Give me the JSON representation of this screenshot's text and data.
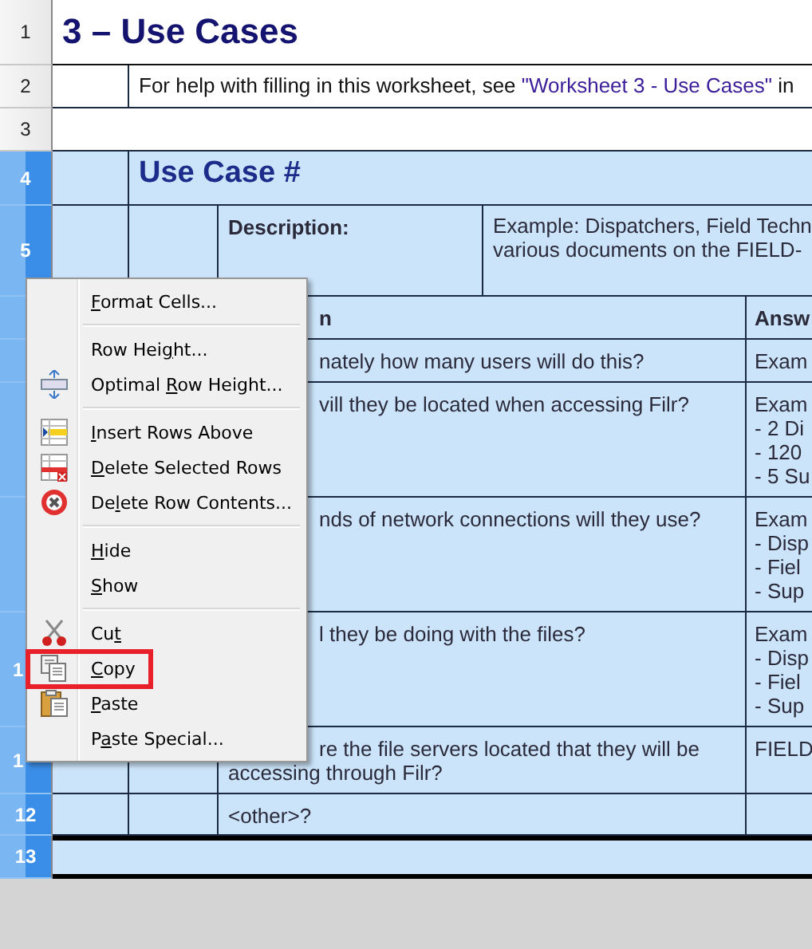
{
  "row_headers": [
    {
      "label": "1",
      "selected": false
    },
    {
      "label": "2",
      "selected": false
    },
    {
      "label": "3",
      "selected": false
    },
    {
      "label": "4",
      "selected": true
    },
    {
      "label": "5",
      "selected": true
    },
    {
      "selected": true
    },
    {
      "selected": true
    },
    {
      "selected": true
    },
    {
      "selected": true
    },
    {
      "label": "1",
      "selected": true,
      "covered": true
    },
    {
      "label": "1",
      "selected": true,
      "covered": true
    },
    {
      "label": "12",
      "selected": true
    },
    {
      "label": "13",
      "selected": true
    }
  ],
  "sheet": {
    "title": "3 – Use Cases",
    "help": {
      "before": "For help with filling in this worksheet, see ",
      "link": "\"Worksheet 3 - Use Cases\"",
      "after": " in"
    },
    "section_title": "Use Case #",
    "description_label": "Description:",
    "description_lines": [
      "Example: Dispatchers, Field Techn",
      "various documents on the FIELD-"
    ],
    "rows": [
      {
        "kind": "header",
        "question": [
          {
            "text": "n",
            "covered": true
          }
        ],
        "answer": [
          "Answ"
        ]
      },
      {
        "kind": "body",
        "question": [
          {
            "text": "nately how many users will do this?",
            "covered": true
          }
        ],
        "answer": [
          "Exam"
        ]
      },
      {
        "kind": "body",
        "question": [
          {
            "text": "vill they be located when accessing Filr?",
            "covered": true
          }
        ],
        "answer": [
          "Exam",
          "- 2 Di",
          "- 120",
          "- 5 Su"
        ]
      },
      {
        "kind": "body",
        "question": [
          {
            "text": "nds of network connections will they use?",
            "covered": true
          }
        ],
        "answer": [
          "Exam",
          "- Disp",
          "- Fiel",
          "- Sup"
        ]
      },
      {
        "kind": "body",
        "question": [
          {
            "text": "l they be doing with the files?",
            "covered": true
          }
        ],
        "answer": [
          "Exam",
          "- Disp",
          "- Fiel",
          "- Sup"
        ]
      },
      {
        "kind": "body",
        "question": [
          {
            "text": "re the file servers located that they will be",
            "covered": true
          },
          {
            "text": "accessing through Filr?"
          }
        ],
        "answer": [
          "FIELD"
        ]
      },
      {
        "kind": "body",
        "question": [
          {
            "text": "<other>?"
          }
        ]
      }
    ]
  },
  "context_menu": [
    {
      "kind": "item",
      "key": "F",
      "after": "ormat Cells...",
      "highlighted": false
    },
    {
      "kind": "separator"
    },
    {
      "kind": "item",
      "before": "Row Hei",
      "key": "g",
      "after": "ht...",
      "highlighted": false
    },
    {
      "kind": "item",
      "before": "Optimal ",
      "key": "R",
      "after": "ow Height...",
      "highlighted": false
    },
    {
      "kind": "separator"
    },
    {
      "kind": "item",
      "key": "I",
      "after": "nsert Rows Above",
      "highlighted": false
    },
    {
      "kind": "item",
      "key": "D",
      "after": "elete Selected Rows",
      "highlighted": false
    },
    {
      "kind": "item",
      "before": "De",
      "key": "l",
      "after": "ete Row Contents...",
      "highlighted": false
    },
    {
      "kind": "separator"
    },
    {
      "kind": "item",
      "key": "H",
      "after": "ide",
      "highlighted": false
    },
    {
      "kind": "item",
      "key": "S",
      "after": "how",
      "highlighted": false
    },
    {
      "kind": "separator"
    },
    {
      "kind": "item",
      "before": "Cu",
      "key": "t",
      "highlighted": false
    },
    {
      "kind": "item",
      "key": "C",
      "after": "opy",
      "highlighted": true
    },
    {
      "kind": "item",
      "key": "P",
      "after": "aste",
      "highlighted": false
    },
    {
      "kind": "item",
      "before": "P",
      "key": "a",
      "after": "ste Special...",
      "highlighted": false
    }
  ]
}
